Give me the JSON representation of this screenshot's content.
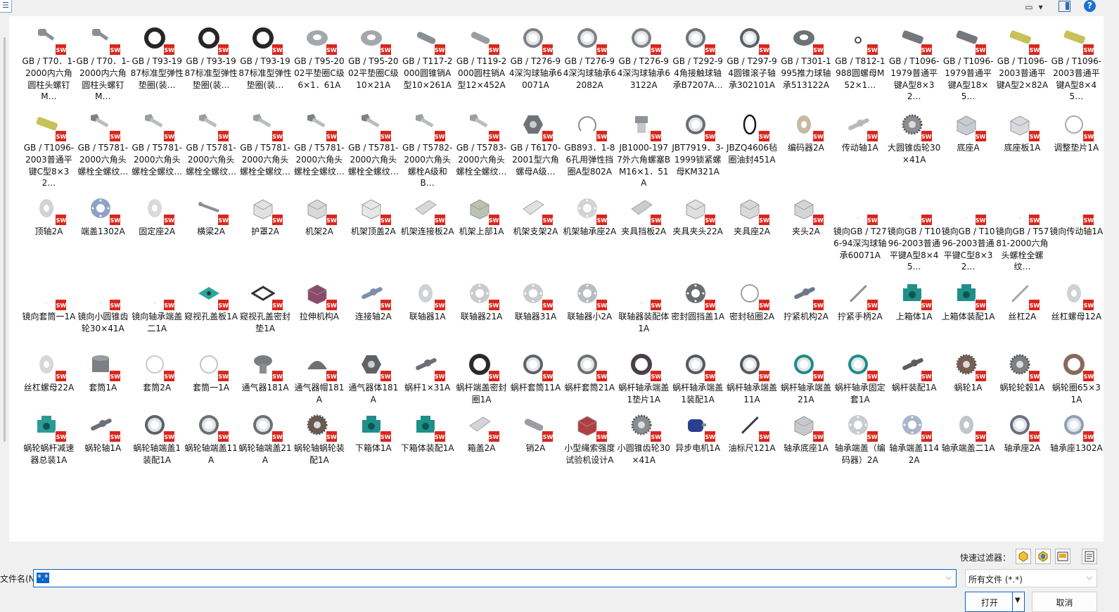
{
  "toolbar": {
    "view_icon": "view-menu-icon",
    "view_arrow": "▾",
    "help_label": "?"
  },
  "items": [
    {
      "label": "GB / T70．1-2000内六角圆柱头螺钉M…",
      "icon": "screw",
      "color": "#8a8f96"
    },
    {
      "label": "GB / T70．1-2000内六角圆柱头螺钉M…",
      "icon": "screw",
      "color": "#8a8f96"
    },
    {
      "label": "GB / T93-1987标准型弹性垫圈(装…",
      "icon": "ring-dark",
      "color": "#262626"
    },
    {
      "label": "GB / T93-1987标准型弹性垫圈(装…",
      "icon": "ring-dark",
      "color": "#262626"
    },
    {
      "label": "GB / T93-1987标准型弹性垫圈(装…",
      "icon": "ring-dark",
      "color": "#262626"
    },
    {
      "label": "GB / T95-2002平垫圈C级6×1．61A",
      "icon": "washer",
      "color": "#a4a7ab"
    },
    {
      "label": "GB / T95-2002平垫圈C级10×21A",
      "icon": "washer",
      "color": "#a4a7ab"
    },
    {
      "label": "GB / T117-2000圆锥销A型10×261A",
      "icon": "pin",
      "color": "#8b8f94"
    },
    {
      "label": "GB / T119-2000圆柱销A型12×452A",
      "icon": "pin",
      "color": "#9a9ea3"
    },
    {
      "label": "GB / T276-94深沟球轴承60071A",
      "icon": "bearing",
      "color": "#7d8288"
    },
    {
      "label": "GB / T276-94深沟球轴承62082A",
      "icon": "bearing",
      "color": "#7d8288"
    },
    {
      "label": "GB / T276-94深沟球轴承63122A",
      "icon": "bearing",
      "color": "#7d8288"
    },
    {
      "label": "GB / T292-94角接触球轴承B7207A…",
      "icon": "bearing",
      "color": "#6f747a"
    },
    {
      "label": "GB / T297-94圆锥滚子轴承302101A",
      "icon": "bearing",
      "color": "#5c6167"
    },
    {
      "label": "GB / T301-1995推力球轴承513122A",
      "icon": "washer",
      "color": "#6d7277"
    },
    {
      "label": "GB / T812-1988圆螺母M52×1…",
      "icon": "ring-small",
      "color": "#4a4d52"
    },
    {
      "label": "GB / T1096-1979普通平键A型8×32…",
      "icon": "key",
      "color": "#74787d"
    },
    {
      "label": "GB / T1096-1979普通平键A型18×5…",
      "icon": "key",
      "color": "#74787d"
    },
    {
      "label": "GB / T1096-2003普通平键A型2×82A",
      "icon": "key",
      "color": "#c8c15a"
    },
    {
      "label": "GB / T1096-2003普通平键A型8×45…",
      "icon": "key",
      "color": "#c8c15a"
    },
    {
      "label": "GB / T1096-2003普通平键C型8×32…",
      "icon": "key",
      "color": "#c8c15a"
    },
    {
      "label": "GB / T5781-2000六角头螺栓全螺纹…",
      "icon": "bolt",
      "color": "#7c8186"
    },
    {
      "label": "GB / T5781-2000六角头螺栓全螺纹…",
      "icon": "bolt",
      "color": "#9b9fa4"
    },
    {
      "label": "GB / T5781-2000六角头螺栓全螺纹…",
      "icon": "bolt",
      "color": "#9b9fa4"
    },
    {
      "label": "GB / T5781-2000六角头螺栓全螺纹…",
      "icon": "bolt",
      "color": "#9b9fa4"
    },
    {
      "label": "GB / T5781-2000六角头螺栓全螺纹…",
      "icon": "bolt",
      "color": "#7c8186"
    },
    {
      "label": "GB / T5781-2000六角头螺栓全螺纹…",
      "icon": "bolt",
      "color": "#7c8186"
    },
    {
      "label": "GB / T5782-2000六角头螺栓A级和B…",
      "icon": "bolt",
      "color": "#9b9fa4"
    },
    {
      "label": "GB / T5783-2000六角头螺栓全螺纹…",
      "icon": "bolt",
      "color": "#9b9fa4"
    },
    {
      "label": "GB / T6170-2001型六角螺母A级…",
      "icon": "nut",
      "color": "#6f7378"
    },
    {
      "label": "GB893．1-86孔用弹性挡圈A型802A",
      "icon": "circlip",
      "color": "#8c8f93"
    },
    {
      "label": "JB1000-1977外六角螺塞BM16×1．51A",
      "icon": "plug",
      "color": "#8f9398"
    },
    {
      "label": "JBT7919．3-1999锁紧螺母KM321A",
      "icon": "bearing",
      "color": "#6a6e73"
    },
    {
      "label": "JBZQ4606毡圈油封451A",
      "icon": "oring",
      "color": "#1a1a1a"
    },
    {
      "label": "编码器2A",
      "icon": "disc-small",
      "color": "#c9b8a2"
    },
    {
      "label": "传动轴1A",
      "icon": "shaft",
      "color": "#b6b9bd"
    },
    {
      "label": "大圆锥齿轮30×41A",
      "icon": "gear",
      "color": "#8b8e92"
    },
    {
      "label": "底座A",
      "icon": "box",
      "color": "#c7cbd3"
    },
    {
      "label": "底座板1A",
      "icon": "box",
      "color": "#d8dadd"
    },
    {
      "label": "调整垫片1A",
      "icon": "ring-thin",
      "color": "#a9acb0"
    },
    {
      "label": "顶轴2A",
      "icon": "disc-small",
      "color": "#cfd2d6"
    },
    {
      "label": "端盖1302A",
      "icon": "flange",
      "color": "#8da2c4"
    },
    {
      "label": "固定座2A",
      "icon": "disc-small",
      "color": "#d8dadd"
    },
    {
      "label": "横梁2A",
      "icon": "wrench",
      "color": "#8b8f94"
    },
    {
      "label": "护罩2A",
      "icon": "box",
      "color": "#e1e2e3"
    },
    {
      "label": "机架2A",
      "icon": "box",
      "color": "#d7d9dc"
    },
    {
      "label": "机架顶盖2A",
      "icon": "box",
      "color": "#e6e7e8"
    },
    {
      "label": "机架连接板2A",
      "icon": "plate",
      "color": "#d6d8da"
    },
    {
      "label": "机架上部1A",
      "icon": "box",
      "color": "#b9c2b0"
    },
    {
      "label": "机架支架2A",
      "icon": "plate",
      "color": "#e0e1e3"
    },
    {
      "label": "机架轴承座2A",
      "icon": "flange",
      "color": "#d0d3d7"
    },
    {
      "label": "夹具挡板2A",
      "icon": "plate",
      "color": "#c9ccd0"
    },
    {
      "label": "夹具夹头22A",
      "icon": "box",
      "color": "#dfe0e1"
    },
    {
      "label": "夹具座2A",
      "icon": "box",
      "color": "#d8d9db"
    },
    {
      "label": "夹头2A",
      "icon": "box",
      "color": "#d3d5d8"
    },
    {
      "label": "镜向GB / T276-94深沟球轴承60071A",
      "icon": "blank",
      "color": "#ffffff"
    },
    {
      "label": "镜向GB / T1096-2003普通平键A型8×45…",
      "icon": "blank",
      "color": "#ffffff"
    },
    {
      "label": "镜向GB / T1096-2003普通平键C型8×32…",
      "icon": "blank",
      "color": "#ffffff"
    },
    {
      "label": "镜向GB / T5781-2000六角头螺栓全螺纹…",
      "icon": "blank",
      "color": "#ffffff"
    },
    {
      "label": "镜向传动轴1A",
      "icon": "blank",
      "color": "#ffffff"
    },
    {
      "label": "镜向套筒一1A",
      "icon": "blank",
      "color": "#ffffff"
    },
    {
      "label": "镜向小圆锥齿轮30×41A",
      "icon": "blank",
      "color": "#ffffff"
    },
    {
      "label": "镜向轴承端盖二1A",
      "icon": "blank",
      "color": "#ffffff"
    },
    {
      "label": "窥视孔盖板1A",
      "icon": "plate-teal",
      "color": "#2aa79a"
    },
    {
      "label": "窥视孔盖密封垫1A",
      "icon": "frame",
      "color": "#333333"
    },
    {
      "label": "拉伸机构A",
      "icon": "box",
      "color": "#8a4a6a"
    },
    {
      "label": "连接轴2A",
      "icon": "shaft",
      "color": "#7d8fa8"
    },
    {
      "label": "联轴器1A",
      "icon": "disc-small",
      "color": "#cfd1d4"
    },
    {
      "label": "联轴器21A",
      "icon": "flange",
      "color": "#c9cbcf"
    },
    {
      "label": "联轴器31A",
      "icon": "flange",
      "color": "#c9cbcf"
    },
    {
      "label": "联轴器小2A",
      "icon": "flange",
      "color": "#b9bcc0"
    },
    {
      "label": "联轴器装配体1A",
      "icon": "blank",
      "color": "#ffffff"
    },
    {
      "label": "密封圆挡盖1A",
      "icon": "flange",
      "color": "#6a6d72"
    },
    {
      "label": "密封毡圈2A",
      "icon": "ring-thin",
      "color": "#9ea1a5"
    },
    {
      "label": "拧紧机构2A",
      "icon": "shaft",
      "color": "#6e7a8a"
    },
    {
      "label": "拧紧手柄2A",
      "icon": "rod",
      "color": "#8b8f94"
    },
    {
      "label": "上箱体1A",
      "icon": "housing",
      "color": "#1f8f8a"
    },
    {
      "label": "上箱体装配1A",
      "icon": "housing",
      "color": "#1f8f8a"
    },
    {
      "label": "丝杠2A",
      "icon": "rod",
      "color": "#a3a6aa"
    },
    {
      "label": "丝杠螺母12A",
      "icon": "disc-small",
      "color": "#cfd1d4"
    },
    {
      "label": "丝杠螺母22A",
      "icon": "disc-small",
      "color": "#d6d8da"
    },
    {
      "label": "套筒1A",
      "icon": "cylinder",
      "color": "#7c7f84"
    },
    {
      "label": "套筒2A",
      "icon": "ring-thin",
      "color": "#c9cbce"
    },
    {
      "label": "套筒一1A",
      "icon": "ring-thin",
      "color": "#c3c5c8"
    },
    {
      "label": "通气器181A",
      "icon": "mushroom",
      "color": "#7a7c80"
    },
    {
      "label": "通气器帽181A",
      "icon": "dome",
      "color": "#6e7074"
    },
    {
      "label": "通气器体181A",
      "icon": "nut",
      "color": "#5f6267"
    },
    {
      "label": "蜗杆1×31A",
      "icon": "shaft",
      "color": "#6c7076"
    },
    {
      "label": "蜗杆端盖密封圈1A",
      "icon": "ring-dark",
      "color": "#2a2a2a"
    },
    {
      "label": "蜗杆套筒11A",
      "icon": "bearing",
      "color": "#5f6368"
    },
    {
      "label": "蜗杆套筒21A",
      "icon": "bearing",
      "color": "#6d7176"
    },
    {
      "label": "蜗杆轴承端盖1垫片1A",
      "icon": "ring-dark",
      "color": "#4a3f4a"
    },
    {
      "label": "蜗杆轴承端盖1装配1A",
      "icon": "bearing",
      "color": "#55595e"
    },
    {
      "label": "蜗杆轴承端盖11A",
      "icon": "bearing",
      "color": "#55595e"
    },
    {
      "label": "蜗杆轴承端盖21A",
      "icon": "bearing",
      "color": "#1e8c88"
    },
    {
      "label": "蜗杆轴承固定套1A",
      "icon": "bearing",
      "color": "#1e8c88"
    },
    {
      "label": "蜗杆装配1A",
      "icon": "shaft",
      "color": "#5a5e63"
    },
    {
      "label": "蜗轮1A",
      "icon": "gear",
      "color": "#7a5e52"
    },
    {
      "label": "蜗轮轮毂1A",
      "icon": "gear",
      "color": "#7d8186"
    },
    {
      "label": "蜗轮圈65×31A",
      "icon": "ring-dark",
      "color": "#8a6a5a"
    },
    {
      "label": "蜗轮蜗杆减速器总装1A",
      "icon": "housing",
      "color": "#2d9a95"
    },
    {
      "label": "蜗轮轴1A",
      "icon": "shaft",
      "color": "#6c7076"
    },
    {
      "label": "蜗轮轴端盖1装配1A",
      "icon": "bearing",
      "color": "#5f6368"
    },
    {
      "label": "蜗轮轴端盖11A",
      "icon": "bearing",
      "color": "#6d7176"
    },
    {
      "label": "蜗轮轴端盖21A",
      "icon": "bearing",
      "color": "#6d7176"
    },
    {
      "label": "蜗轮轴蜗轮装配1A",
      "icon": "gear",
      "color": "#6a5a50"
    },
    {
      "label": "下箱体1A",
      "icon": "housing",
      "color": "#1f8f8a"
    },
    {
      "label": "下箱体装配1A",
      "icon": "housing",
      "color": "#1f8f8a"
    },
    {
      "label": "箱盖2A",
      "icon": "plate",
      "color": "#d3d5d8"
    },
    {
      "label": "销2A",
      "icon": "pin",
      "color": "#9a9ea3"
    },
    {
      "label": "小型绳索强度试验机设计A",
      "icon": "box",
      "color": "#b04040"
    },
    {
      "label": "小圆锥齿轮30×41A",
      "icon": "gear",
      "color": "#8a8d91"
    },
    {
      "label": "异步电机1A",
      "icon": "motor",
      "color": "#2a3f8f"
    },
    {
      "label": "油标尺121A",
      "icon": "rod",
      "color": "#3c3f44"
    },
    {
      "label": "轴承底座1A",
      "icon": "box",
      "color": "#c7c9cc"
    },
    {
      "label": "轴承端盖（编码器）2A",
      "icon": "flange",
      "color": "#c9cbcf"
    },
    {
      "label": "轴承端盖1142A",
      "icon": "flange",
      "color": "#a9b6c9"
    },
    {
      "label": "轴承端盖二1A",
      "icon": "disc-small",
      "color": "#c3c5c8"
    },
    {
      "label": "轴承座2A",
      "icon": "bearing",
      "color": "#6a7080"
    },
    {
      "label": "轴承座1302A",
      "icon": "bearing",
      "color": "#8fa0bb"
    }
  ],
  "sw_badge": "SW",
  "filter_label": "快速过滤器：",
  "filename_label": "文件名(N):",
  "filename_value": "*.*",
  "filetype_value": "所有文件 (*.*)",
  "open_label": "打开",
  "cancel_label": "取消"
}
